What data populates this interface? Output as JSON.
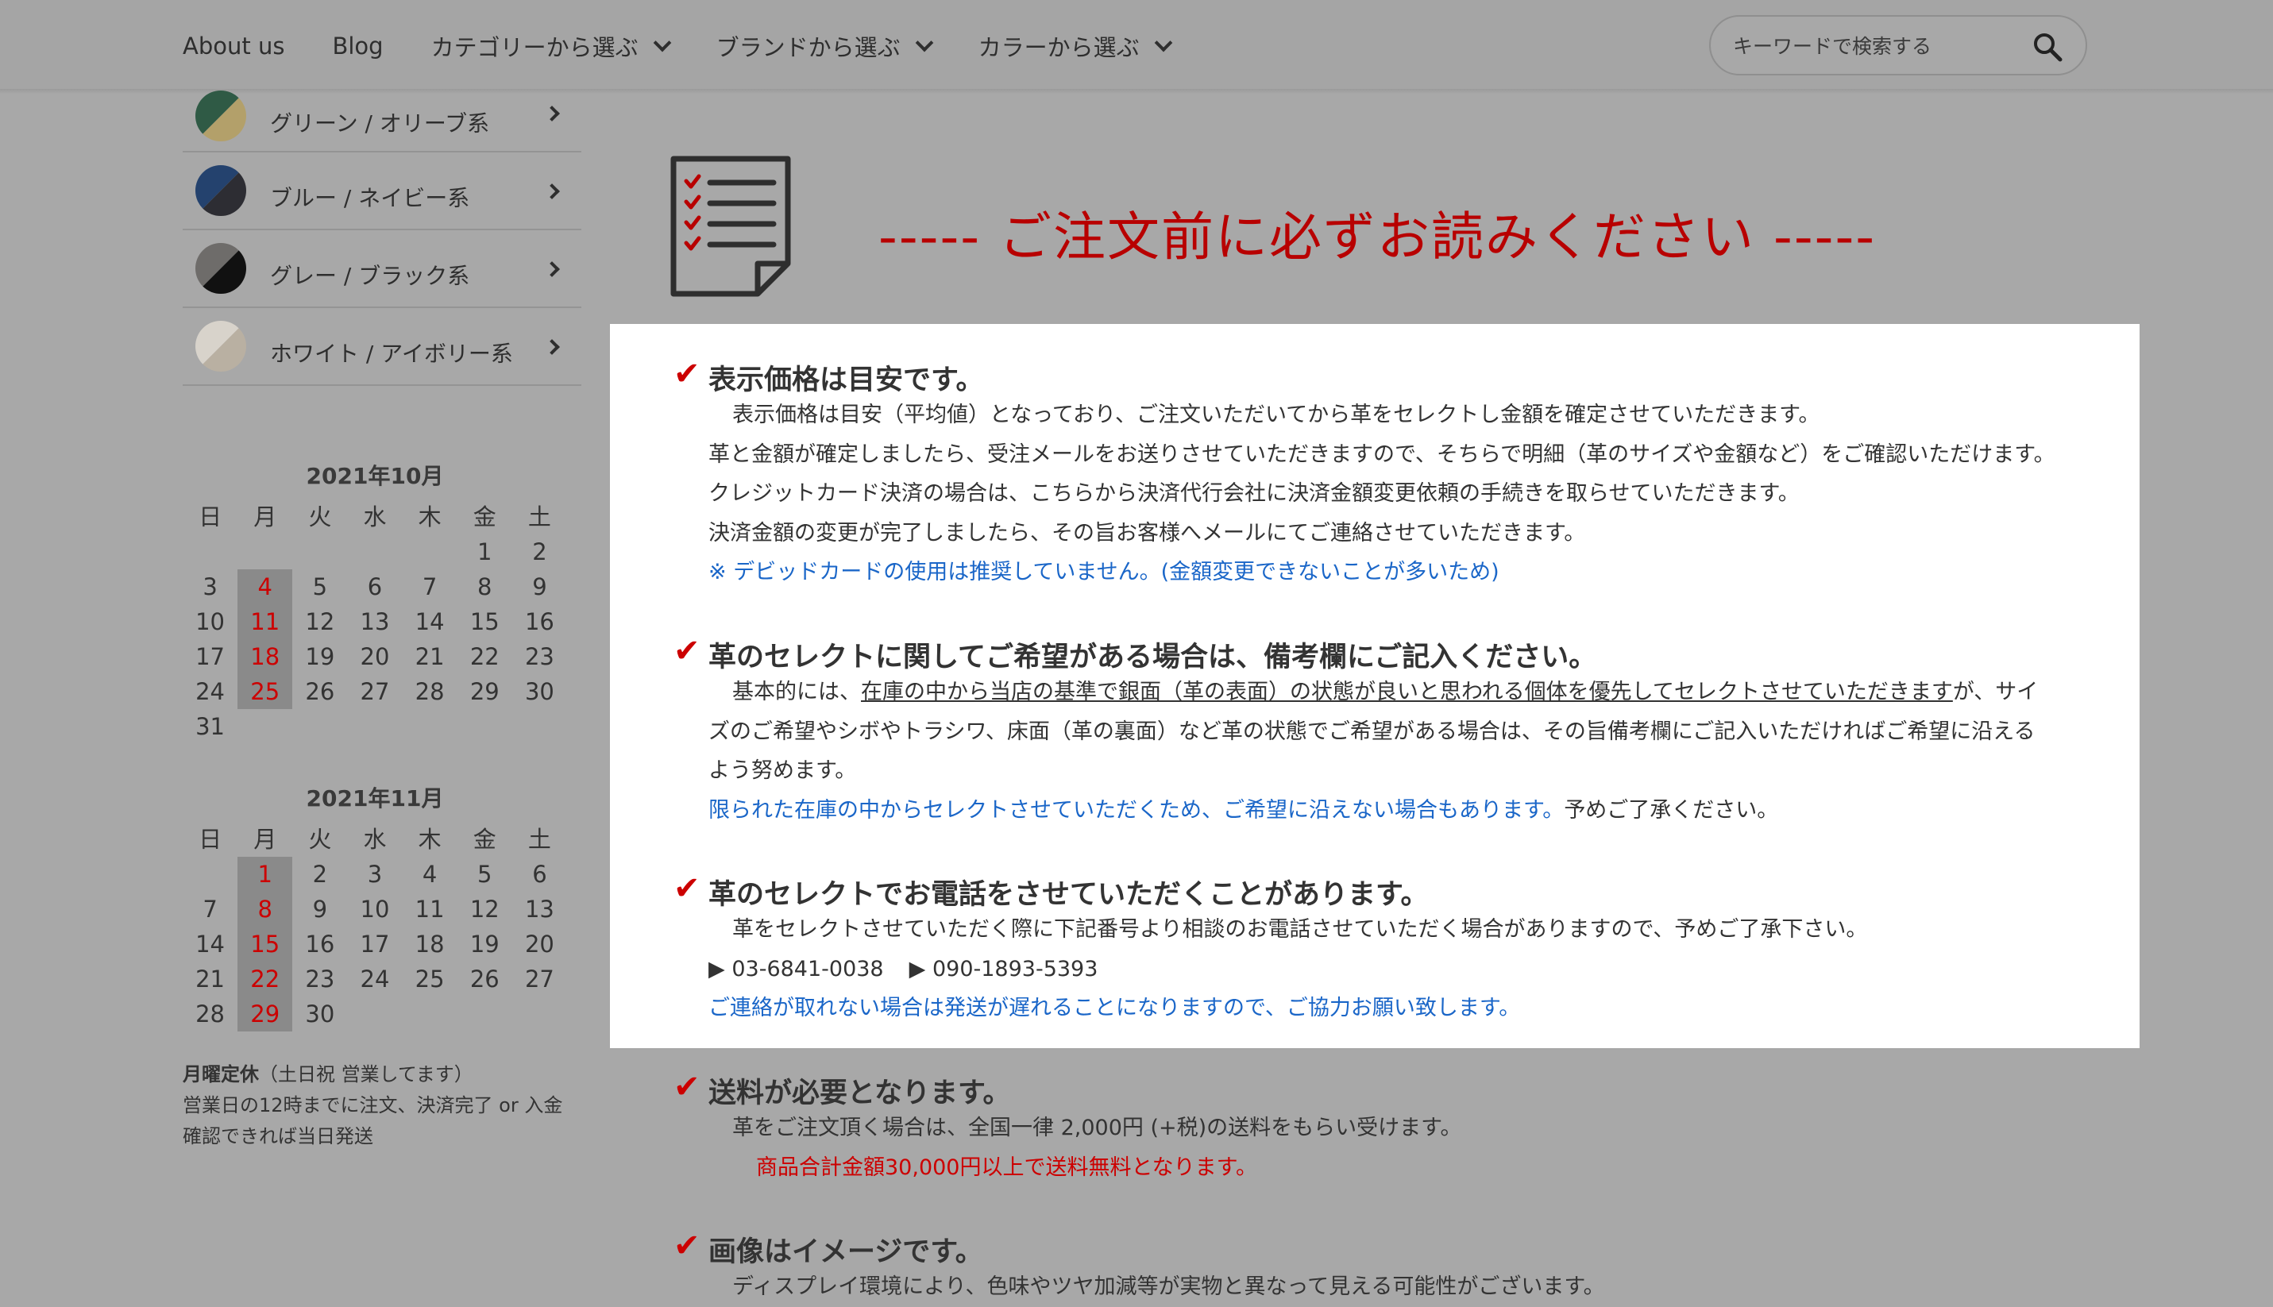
{
  "header": {
    "nav": [
      {
        "label": "About us",
        "dropdown": false
      },
      {
        "label": "Blog",
        "dropdown": false
      },
      {
        "label": "カテゴリーから選ぶ",
        "dropdown": true
      },
      {
        "label": "ブランドから選ぶ",
        "dropdown": true
      },
      {
        "label": "カラーから選ぶ",
        "dropdown": true
      }
    ],
    "search_placeholder": "キーワードで検索する"
  },
  "sidebar": {
    "colors": [
      {
        "label": "グリーン / オリーブ系",
        "c1": "#2f5a45",
        "c2": "#b3a06a"
      },
      {
        "label": "ブルー / ネイビー系",
        "c1": "#24426e",
        "c2": "#2d2d33"
      },
      {
        "label": "グレー / ブラック系",
        "c1": "#6e6c6a",
        "c2": "#111111"
      },
      {
        "label": "ホワイト / アイボリー系",
        "c1": "#d8d3cb",
        "c2": "#b9b0a2"
      }
    ],
    "calendars": [
      {
        "title": "2021年10月",
        "weekdays": [
          "日",
          "月",
          "火",
          "水",
          "木",
          "金",
          "土"
        ],
        "weeks": [
          [
            "",
            "",
            "",
            "",
            "",
            "1",
            "2"
          ],
          [
            "3",
            "4",
            "5",
            "6",
            "7",
            "8",
            "9"
          ],
          [
            "10",
            "11",
            "12",
            "13",
            "14",
            "15",
            "16"
          ],
          [
            "17",
            "18",
            "19",
            "20",
            "21",
            "22",
            "23"
          ],
          [
            "24",
            "25",
            "26",
            "27",
            "28",
            "29",
            "30"
          ],
          [
            "31",
            "",
            "",
            "",
            "",
            "",
            ""
          ]
        ],
        "holidays": [
          "4",
          "11",
          "18",
          "25"
        ]
      },
      {
        "title": "2021年11月",
        "weekdays": [
          "日",
          "月",
          "火",
          "水",
          "木",
          "金",
          "土"
        ],
        "weeks": [
          [
            "",
            "1",
            "2",
            "3",
            "4",
            "5",
            "6"
          ],
          [
            "7",
            "8",
            "9",
            "10",
            "11",
            "12",
            "13"
          ],
          [
            "14",
            "15",
            "16",
            "17",
            "18",
            "19",
            "20"
          ],
          [
            "21",
            "22",
            "23",
            "24",
            "25",
            "26",
            "27"
          ],
          [
            "28",
            "29",
            "30",
            "",
            "",
            "",
            ""
          ]
        ],
        "holidays": [
          "1",
          "8",
          "15",
          "22",
          "29"
        ]
      }
    ],
    "note_bold": "月曜定休",
    "note_rest": "（土日祝 営業してます）",
    "note_line2": "営業日の12時までに注文、決済完了 or 入金確認できれば当日発送"
  },
  "notice": {
    "title": "----- ご注文前に必ずお読みください -----",
    "sections": {
      "s1": {
        "head": "表示価格は目安です。",
        "l1": "表示価格は目安（平均値）となっており、ご注文いただいてから革をセレクトし金額を確定させていただきます。",
        "l2": "革と金額が確定しましたら、受注メールをお送りさせていただきますので、そちらで明細（革のサイズや金額など）をご確認いただけます。",
        "l3": "クレジットカード決済の場合は、こちらから決済代行会社に決済金額変更依頼の手続きを取らせていただきます。",
        "l4": "決済金額の変更が完了しましたら、その旨お客様へメールにてご連絡させていただきます。",
        "l5": "※ デビッドカードの使用は推奨していません。(金額変更できないことが多いため)"
      },
      "s2": {
        "head": "革のセレクトに関してご希望がある場合は、備考欄にご記入ください。",
        "p_pre": "基本的には、",
        "p_u": "在庫の中から当店の基準で銀面（革の表面）の状態が良いと思われる個体を優先してセレクトさせていただきます",
        "p_post": "が、サイズのご希望やシボやトラシワ、床面（革の裏面）など革の状態でご希望がある場合は、その旨備考欄にご記入いただければご希望に沿えるよう努めます。",
        "blue": "限られた在庫の中からセレクトさせていただくため、ご希望に沿えない場合もあります。",
        "tail": "予めご了承ください。"
      },
      "s3": {
        "head": "革のセレクトでお電話をさせていただくことがあります。",
        "l1": "革をセレクトさせていただく際に下記番号より相談のお電話させていただく場合がありますので、予めご了承下さい。",
        "phone1": "▶ 03-6841-0038",
        "phone2": "▶ 090-1893-5393",
        "blue": "ご連絡が取れない場合は発送が遅れることになりますので、ご協力お願い致します。"
      },
      "s4": {
        "head": "送料が必要となります。",
        "l1": "革をご注文頂く場合は、全国一律 2,000円 (+税)の送料をもらい受けます。",
        "red": "商品合計金額30,000円以上で送料無料となります。"
      },
      "s5": {
        "head": "画像はイメージです。",
        "l1": "ディスプレイ環境により、色味やツヤ加減等が実物と異なって見える可能性がございます。"
      }
    }
  }
}
